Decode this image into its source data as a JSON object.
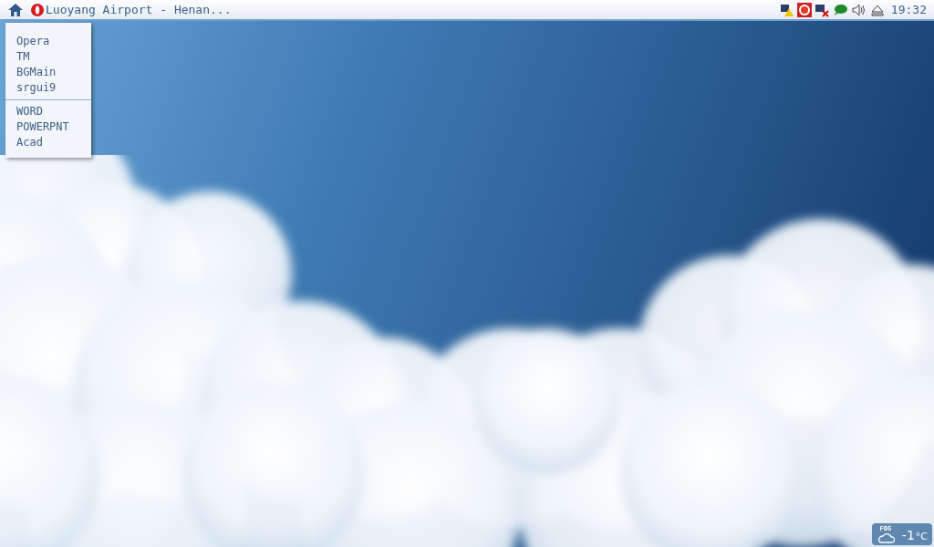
{
  "taskbar": {
    "window_title": "Luoyang Airport - Henan...",
    "clock": "19:32"
  },
  "menu": {
    "groups": [
      [
        "Opera",
        "TM",
        "BGMain",
        "srgui9"
      ],
      [
        "WORD",
        "POWERPNT",
        "Acad"
      ]
    ]
  },
  "weather": {
    "condition": "FOG",
    "temperature": "-1",
    "unit": "°C"
  }
}
